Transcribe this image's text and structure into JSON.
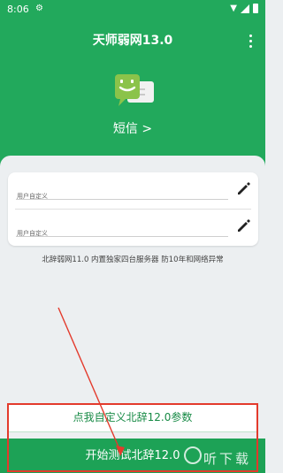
{
  "status_bar": {
    "time": "8:06"
  },
  "app": {
    "title": "天师弱网13.0"
  },
  "sms": {
    "label": "短信 >",
    "icon": "sms-robot-icon"
  },
  "fields": [
    {
      "placeholder": "用户自定义",
      "icon": "pencil-icon"
    },
    {
      "placeholder": "用户自定义",
      "icon": "pencil-icon"
    }
  ],
  "note": "北辞弱网11.0 内置独家四台服务器 防10年和网络异常",
  "buttons": {
    "config": "点我自定义北辞12.0参数",
    "start": "开始测试北辞12.0"
  },
  "watermark": "听下载",
  "colors": {
    "primary_green": "#22a95c",
    "button_green": "#1da256",
    "annotation_red": "#e33a2c"
  }
}
